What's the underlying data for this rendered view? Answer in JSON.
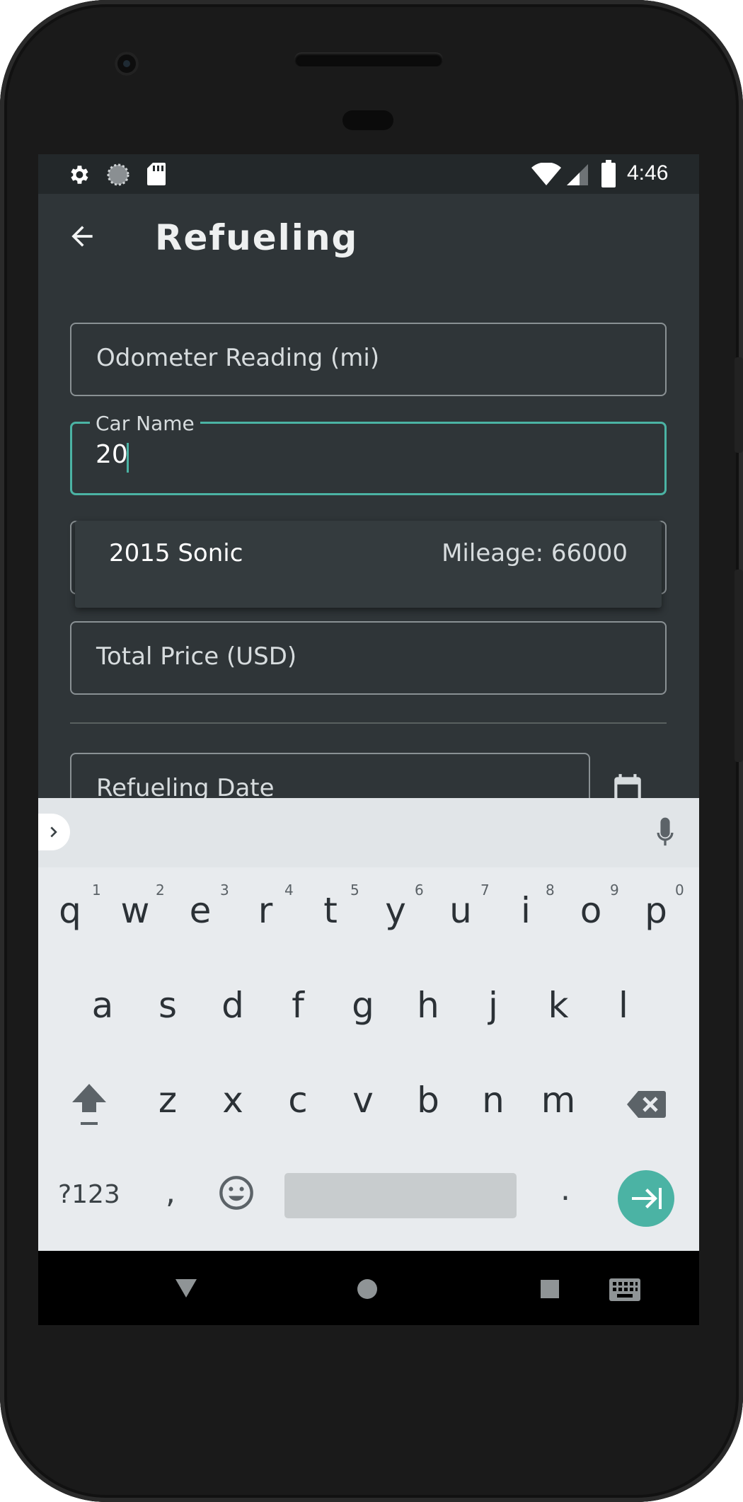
{
  "status_bar": {
    "time": "4:46",
    "icons": [
      "gear-icon",
      "loading-icon",
      "sd-card-icon",
      "wifi-icon",
      "signal-icon",
      "battery-icon"
    ]
  },
  "app_bar": {
    "title": "Refueling",
    "back_icon": "arrow-left-icon"
  },
  "form": {
    "odometer_placeholder": "Odometer Reading (mi)",
    "car_name_label": "Car Name",
    "car_name_value": "20",
    "suggestion": {
      "name": "2015 Sonic",
      "mileage": "Mileage: 66000"
    },
    "total_price_placeholder": "Total Price (USD)",
    "refueling_date_placeholder": "Refueling Date"
  },
  "keyboard": {
    "row1": [
      {
        "key": "q",
        "hint": "1"
      },
      {
        "key": "w",
        "hint": "2"
      },
      {
        "key": "e",
        "hint": "3"
      },
      {
        "key": "r",
        "hint": "4"
      },
      {
        "key": "t",
        "hint": "5"
      },
      {
        "key": "y",
        "hint": "6"
      },
      {
        "key": "u",
        "hint": "7"
      },
      {
        "key": "i",
        "hint": "8"
      },
      {
        "key": "o",
        "hint": "9"
      },
      {
        "key": "p",
        "hint": "0"
      }
    ],
    "row2": [
      "a",
      "s",
      "d",
      "f",
      "g",
      "h",
      "j",
      "k",
      "l"
    ],
    "row3": [
      "z",
      "x",
      "c",
      "v",
      "b",
      "n",
      "m"
    ],
    "symbols_label": "?123",
    "comma": ",",
    "period": ".",
    "accent_color": "#4bb3a4"
  },
  "colors": {
    "background": "#2f3538",
    "status_bar": "#23282a",
    "accent": "#4bb3a4"
  }
}
